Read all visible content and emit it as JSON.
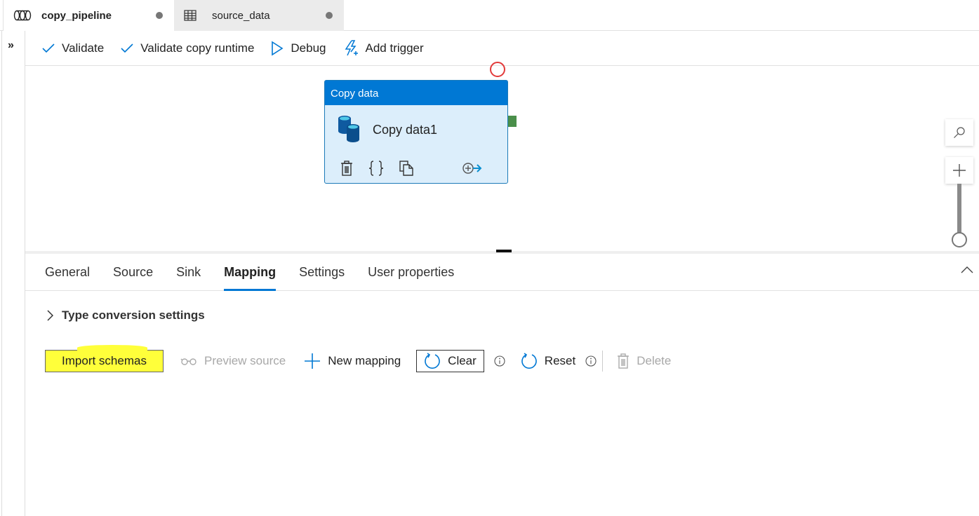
{
  "tabs": [
    {
      "label": "copy_pipeline",
      "icon": "pipeline-icon",
      "unsaved": true,
      "active": true
    },
    {
      "label": "source_data",
      "icon": "table-icon",
      "unsaved": true,
      "active": false
    }
  ],
  "sidebar": {
    "expand_icon": "double-chevron-right-icon"
  },
  "toolbar": {
    "validate": "Validate",
    "validate_copy_runtime": "Validate copy runtime",
    "debug": "Debug",
    "add_trigger": "Add trigger"
  },
  "canvas": {
    "activity": {
      "type": "Copy data",
      "name": "Copy data1",
      "header_color": "#0078d4"
    },
    "zoom_controls": {
      "search_icon": "search-icon",
      "zoom_in_icon": "plus-icon"
    }
  },
  "properties": {
    "tabs": [
      "General",
      "Source",
      "Sink",
      "Mapping",
      "Settings",
      "User properties"
    ],
    "active_tab": "Mapping",
    "mapping": {
      "type_conversion_label": "Type conversion settings",
      "buttons": {
        "import_schemas": "Import schemas",
        "preview_source": "Preview source",
        "new_mapping": "New mapping",
        "clear": "Clear",
        "reset": "Reset",
        "delete": "Delete"
      },
      "highlight_color": "#ffff3a"
    }
  }
}
